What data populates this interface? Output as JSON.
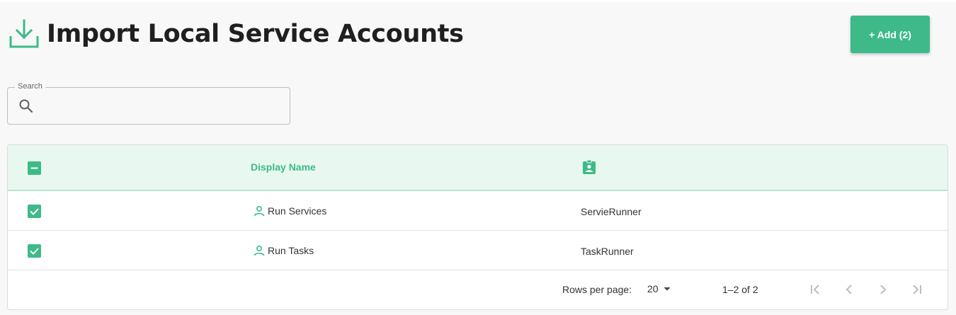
{
  "header": {
    "title": "Import Local Service Accounts",
    "add_label": "+ Add (2)"
  },
  "search": {
    "label": "Search",
    "value": "",
    "placeholder": ""
  },
  "table": {
    "columns": [
      "Display Name"
    ],
    "rows": [
      {
        "display_name": "Run Services",
        "username": "ServieRunner",
        "checked": true
      },
      {
        "display_name": "Run Tasks",
        "username": "TaskRunner",
        "checked": true
      }
    ]
  },
  "pagination": {
    "rows_per_page_label": "Rows per page:",
    "rows_per_page": "20",
    "range": "1–2 of 2"
  },
  "colors": {
    "accent": "#3dba88",
    "header_bg": "#e8f8f0",
    "page_bg": "#f8f8f8"
  },
  "icons": {
    "header": "download-icon",
    "search": "search-icon",
    "id_column": "badge-icon",
    "row": "person-icon"
  }
}
